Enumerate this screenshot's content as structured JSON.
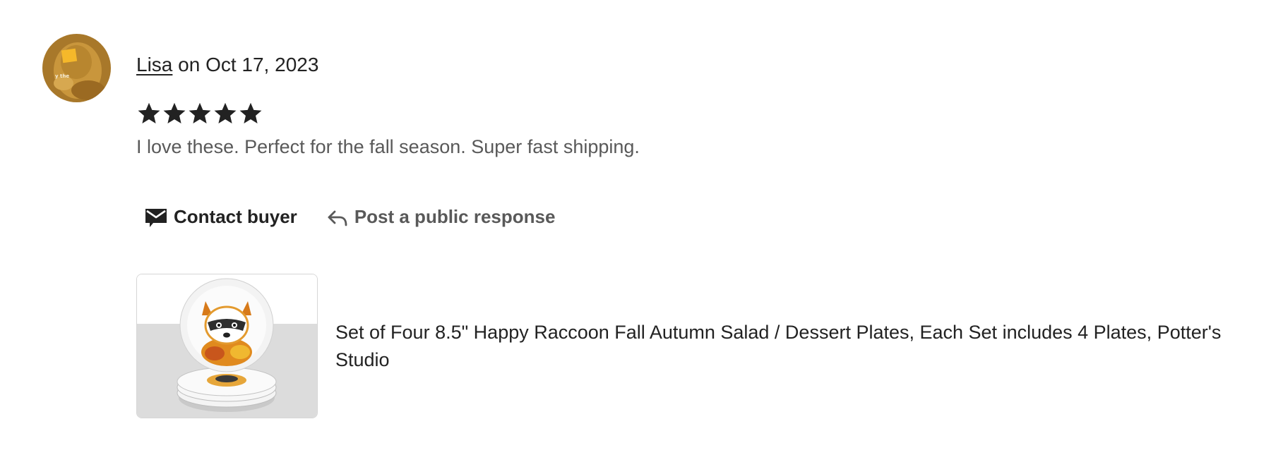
{
  "review": {
    "reviewer_name": "Lisa",
    "date_text": " on Oct 17, 2023",
    "rating": 5,
    "rating_max": 5,
    "text": "I love these. Perfect for the fall season. Super fast shipping.",
    "avatar_icon": "user-avatar-photo"
  },
  "actions": {
    "contact_label": "Contact buyer",
    "contact_icon": "envelope-icon",
    "public_label": "Post a public response",
    "public_icon": "reply-arrow-icon"
  },
  "listing": {
    "title": "Set of Four 8.5\" Happy Raccoon Fall Autumn Salad / Dessert Plates, Each Set includes 4 Plates, Potter's Studio",
    "thumbnail_icon": "raccoon-plates-photo"
  },
  "colors": {
    "text_primary": "#222222",
    "text_secondary": "#595959",
    "star": "#222222",
    "thumb_border": "#d6d6d6"
  }
}
